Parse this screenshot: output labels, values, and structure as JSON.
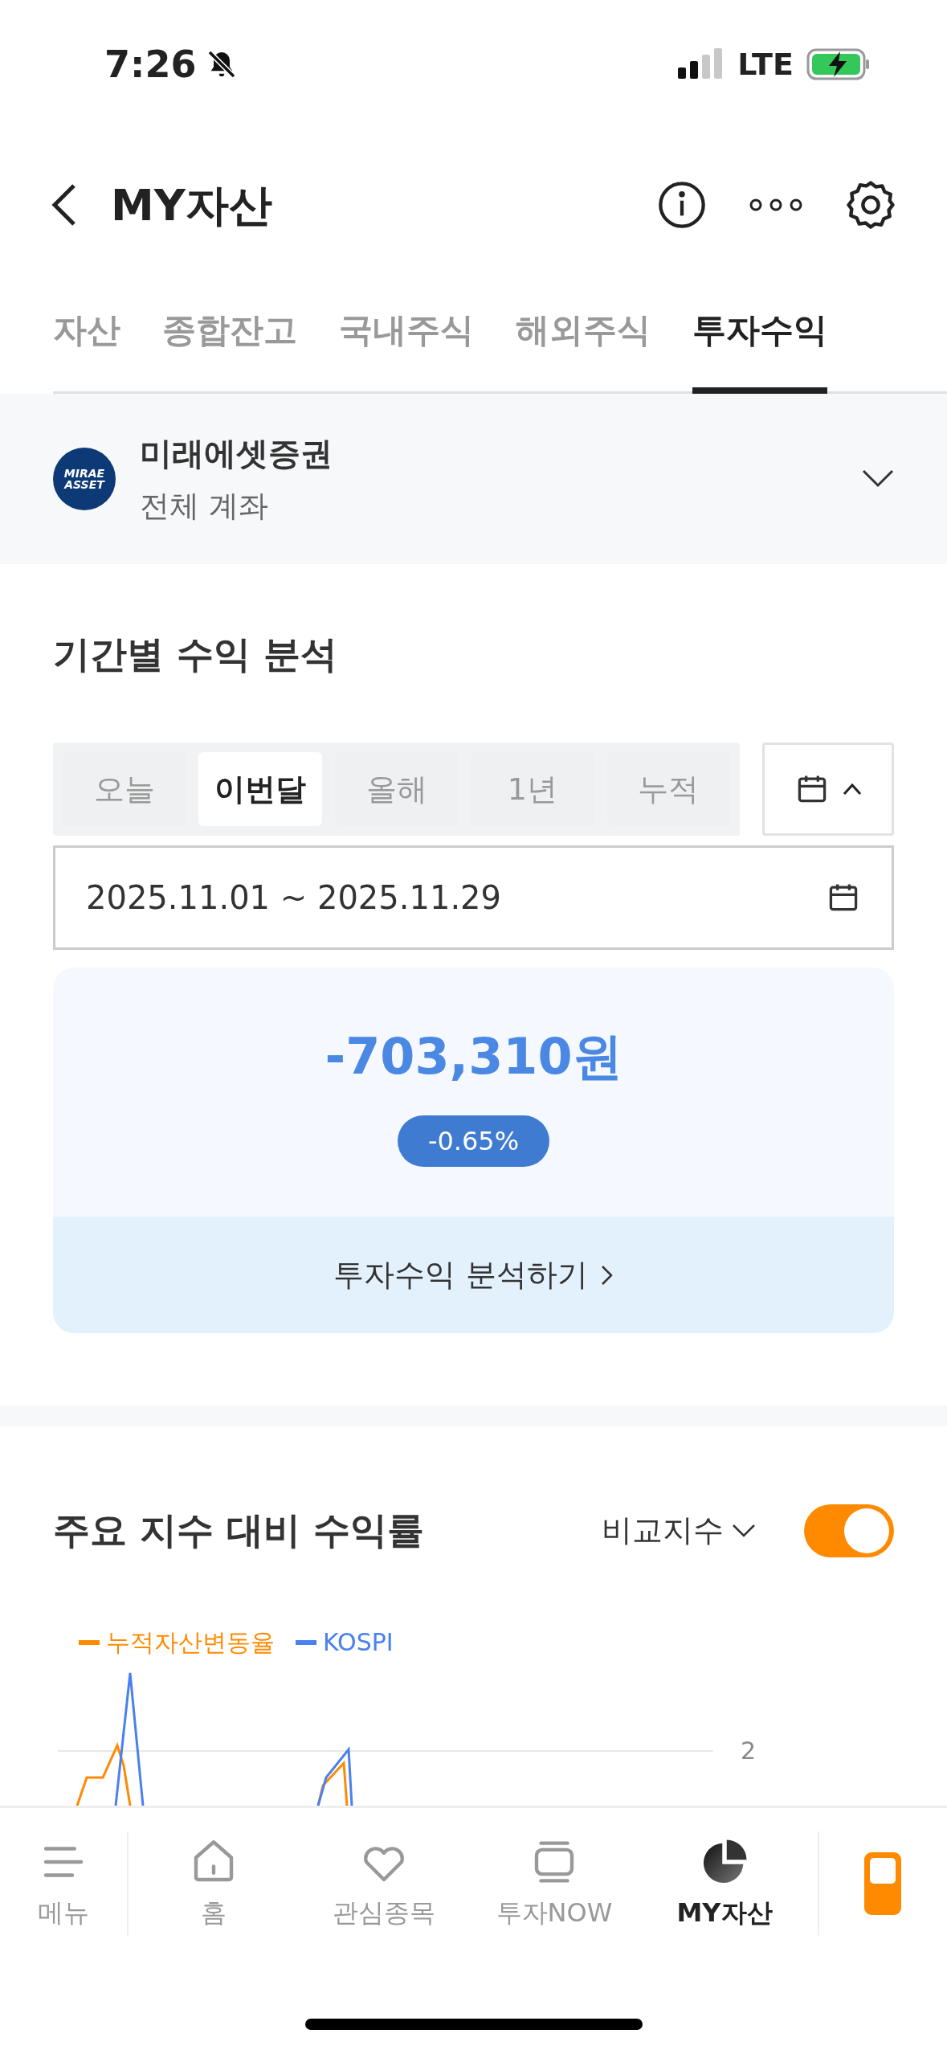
{
  "status_bar": {
    "time": "7:26",
    "network": "LTE"
  },
  "header": {
    "title": "MY자산"
  },
  "tabs": [
    {
      "label": "자산",
      "selected": false
    },
    {
      "label": "종합잔고",
      "selected": false
    },
    {
      "label": "국내주식",
      "selected": false
    },
    {
      "label": "해외주식",
      "selected": false
    },
    {
      "label": "투자수익",
      "selected": true
    }
  ],
  "account": {
    "logo_text": [
      "MIRAE",
      "ASSET"
    ],
    "name": "미래에셋증권",
    "subtitle": "전체 계좌"
  },
  "analysis": {
    "title": "기간별 수익 분석",
    "periods": [
      {
        "label": "오늘",
        "selected": false
      },
      {
        "label": "이번달",
        "selected": true
      },
      {
        "label": "올해",
        "selected": false
      },
      {
        "label": "1년",
        "selected": false
      },
      {
        "label": "누적",
        "selected": false
      }
    ],
    "date_range": "2025.11.01 ~ 2025.11.29",
    "amount": "-703,310원",
    "rate": "-0.65%",
    "link": "투자수익 분석하기"
  },
  "comparison": {
    "title": "주요 지수 대비 수익률",
    "dropdown": "비교지수",
    "toggle": {
      "on": true
    },
    "legend": [
      {
        "label": "누적자산변동율",
        "color": "#ff8a00"
      },
      {
        "label": "KOSPI",
        "color": "#4a80f0"
      }
    ],
    "axis_label": "2"
  },
  "bottom_nav": [
    {
      "label": "메뉴",
      "selected": false
    },
    {
      "label": "홈",
      "selected": false
    },
    {
      "label": "관심종목",
      "selected": false
    },
    {
      "label": "투자NOW",
      "selected": false
    },
    {
      "label": "MY자산",
      "selected": true
    }
  ]
}
